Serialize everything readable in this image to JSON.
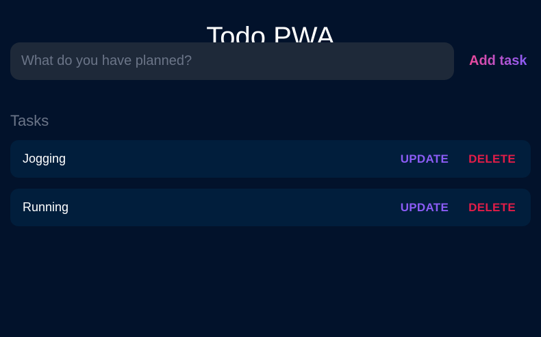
{
  "app": {
    "title": "Todo PWA"
  },
  "new_task": {
    "value": "",
    "placeholder": "What do you have planned?",
    "add_label": "Add task"
  },
  "tasks_section": {
    "heading": "Tasks",
    "items": [
      {
        "label": "Jogging",
        "update_label": "UPDATE",
        "delete_label": "DELETE"
      },
      {
        "label": "Running",
        "update_label": "UPDATE",
        "delete_label": "DELETE"
      }
    ]
  },
  "colors": {
    "background": "#02122b",
    "input_bg": "#1e2939",
    "task_bg": "#011e3c",
    "update": "#8b5cf6",
    "delete": "#e11d48",
    "add_gradient_start": "#ec4899",
    "add_gradient_end": "#8b5cf6"
  }
}
